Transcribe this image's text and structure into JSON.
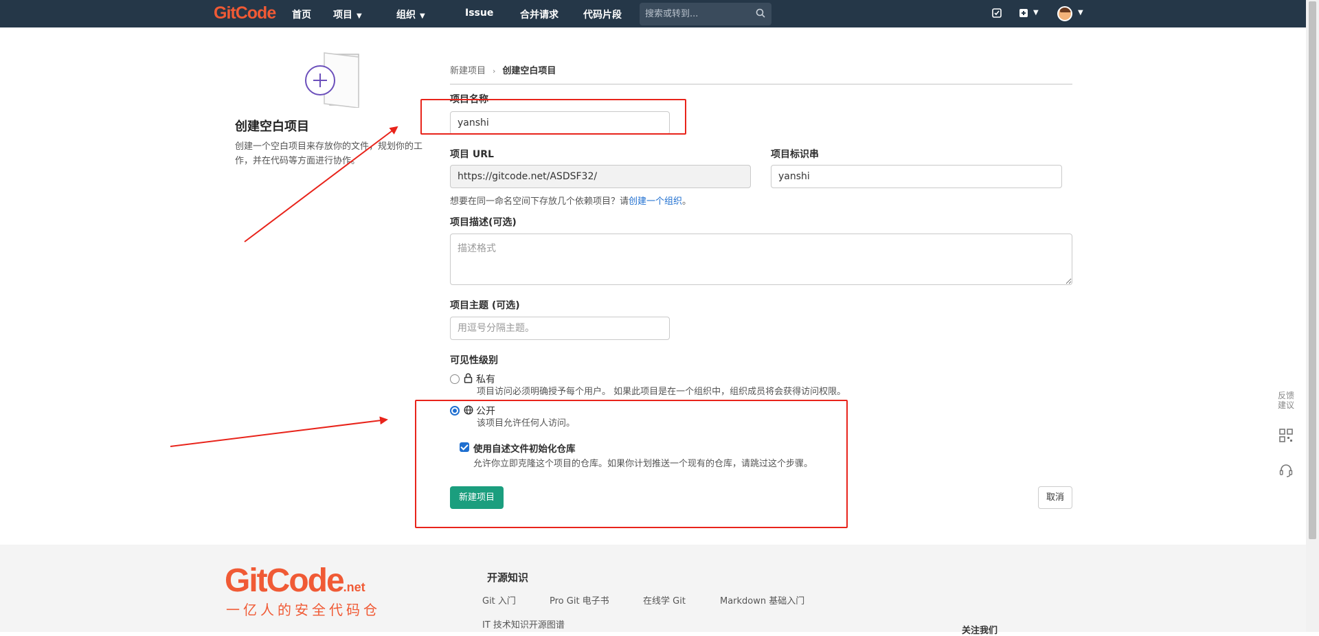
{
  "nav": {
    "logo": "GitCode",
    "items": [
      {
        "label": "首页"
      },
      {
        "label": "项目"
      },
      {
        "label": "组织"
      },
      {
        "label": "Issue"
      },
      {
        "label": "合并请求"
      },
      {
        "label": "代码片段"
      }
    ],
    "search_placeholder": "搜索或转到..."
  },
  "left": {
    "title": "创建空白项目",
    "description": "创建一个空白项目来存放你的文件，规划你的工作，并在代码等方面进行协作。"
  },
  "breadcrumb": {
    "parent": "新建项目",
    "current": "创建空白项目"
  },
  "form": {
    "name_label": "项目名称",
    "name_value": "yanshi",
    "url_label": "项目 URL",
    "url_value": "https://gitcode.net/ASDSF32/",
    "slug_label": "项目标识串",
    "slug_value": "yanshi",
    "group_hint": "想要在同一命名空间下存放几个依赖项目？请",
    "group_link": "创建一个组织",
    "group_hint_end": "。",
    "desc_label": "项目描述(可选)",
    "desc_placeholder": "描述格式",
    "topic_label": "项目主题 (可选)",
    "topic_placeholder": "用逗号分隔主题。",
    "visibility_label": "可见性级别",
    "visibility": [
      {
        "title": "私有",
        "desc": "项目访问必须明确授予每个用户。 如果此项目是在一个组织中，组织成员将会获得访问权限。",
        "selected": false
      },
      {
        "title": "公开",
        "desc": "该项目允许任何人访问。",
        "selected": true
      }
    ],
    "readme_label": "使用自述文件初始化仓库",
    "readme_desc": "允许你立即克隆这个项目的仓库。如果你计划推送一个现有的仓库，请跳过这个步骤。",
    "readme_checked": true,
    "submit": "新建项目",
    "cancel": "取消"
  },
  "float": {
    "feedback": "反馈\n建议"
  },
  "footer": {
    "logo": "GitCode",
    "logo_suffix": ".net",
    "slogan": "一亿人的安全代码仓",
    "section_title": "开源知识",
    "links": [
      "Git 入门",
      "Pro Git 电子书",
      "在线学 Git",
      "Markdown 基础入门",
      "IT 技术知识开源图谱"
    ],
    "follow": "关注我们"
  },
  "colors": {
    "nav_bg": "#253748",
    "brand": "#f05a35",
    "primary_button": "#1b9e7e",
    "annotation_red": "#e8231a",
    "link": "#1f6fd0"
  }
}
